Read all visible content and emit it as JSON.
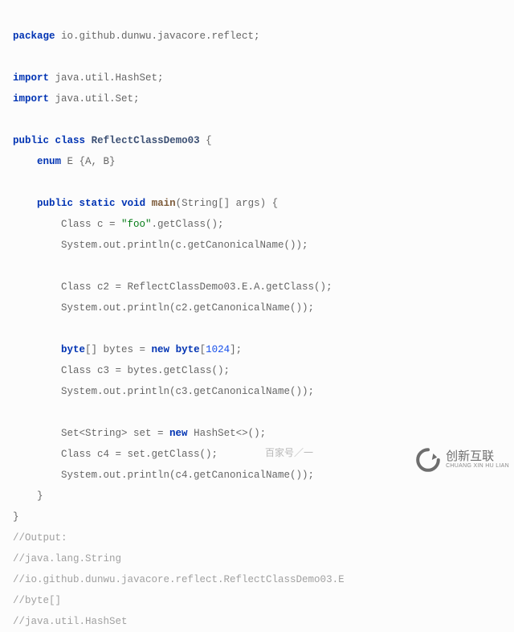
{
  "code": {
    "pkg_kw": "package",
    "pkg_name": " io.github.dunwu.javacore.reflect;",
    "import_kw": "import",
    "import1": " java.util.HashSet;",
    "import2": " java.util.Set;",
    "public_kw": "public",
    "class_kw": "class",
    "static_kw": "static",
    "void_kw": "void",
    "new_kw": "new",
    "enum_kw": "enum",
    "byte_kw": "byte",
    "class_name": "ReflectClassDemo03",
    "main_name": "main",
    "brace_open": " {",
    "enum_decl": " E {A, B}",
    "main_sig_args": "(String[] args) {",
    "line_c": "        Class c = ",
    "str_foo": "\"foo\"",
    "after_foo": ".getClass();",
    "println_c": "        System.out.println(c.getCanonicalName());",
    "line_c2": "        Class c2 = ReflectClassDemo03.E.A.getClass();",
    "println_c2": "        System.out.println(c2.getCanonicalName());",
    "bytes_pre": "[] bytes = ",
    "bytes_post": "[",
    "num_1024": "1024",
    "bytes_end": "];",
    "indent8": "        ",
    "line_c3": "        Class c3 = bytes.getClass();",
    "println_c3": "        System.out.println(c3.getCanonicalName());",
    "set_pre": "        Set<String> set = ",
    "set_post": " HashSet<>();",
    "line_c4": "        Class c4 = set.getClass();",
    "println_c4": "        System.out.println(c4.getCanonicalName());",
    "brace_close_inner": "    }",
    "brace_close_outer": "}",
    "cmt_output": "//Output:",
    "cmt_1": "//java.lang.String",
    "cmt_2": "//io.github.dunwu.javacore.reflect.ReflectClassDemo03.E",
    "cmt_3": "//byte[]",
    "cmt_4": "//java.util.HashSet"
  },
  "watermark": {
    "center_text": "百家号／一",
    "brand_cn": "创新互联",
    "brand_en": "CHUANG XIN HU LIAN"
  }
}
